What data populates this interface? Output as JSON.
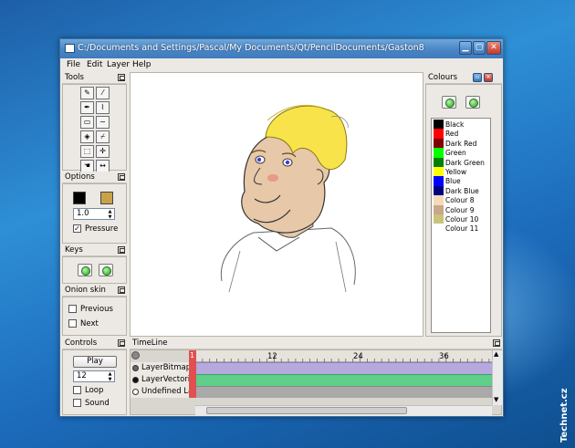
{
  "window": {
    "title": "C:/Documents and Settings/Pascal/My Documents/Qt/PencilDocuments/Gaston8"
  },
  "menu": [
    "File",
    "Edit",
    "Layer",
    "Help"
  ],
  "panels": {
    "tools": "Tools",
    "options": "Options",
    "keys": "Keys",
    "onion": "Onion skin",
    "controls": "Controls",
    "colours": "Colours",
    "timeline": "TimeLine"
  },
  "options": {
    "width_value": "1.0",
    "pressure_label": "Pressure",
    "pressure_checked": "✓",
    "stroke_color": "#000000",
    "fill_color": "#c8a24a"
  },
  "onion": {
    "previous_label": "Previous",
    "next_label": "Next"
  },
  "controls": {
    "play_label": "Play",
    "fps_value": "12",
    "loop_label": "Loop",
    "sound_label": "Sound"
  },
  "colours": [
    {
      "name": "Black",
      "color": "#000000"
    },
    {
      "name": "Red",
      "color": "#ff0000"
    },
    {
      "name": "Dark Red",
      "color": "#800000"
    },
    {
      "name": "Green",
      "color": "#00ff00"
    },
    {
      "name": "Dark Green",
      "color": "#008000"
    },
    {
      "name": "Yellow",
      "color": "#ffff00"
    },
    {
      "name": "Blue",
      "color": "#0000ff"
    },
    {
      "name": "Dark Blue",
      "color": "#000080"
    },
    {
      "name": "Colour 8",
      "color": "#f5d9b8"
    },
    {
      "name": "Colour 9",
      "color": "#c8a88a"
    },
    {
      "name": "Colour 10",
      "color": "#c9c47a"
    },
    {
      "name": "Colour 11",
      "color": "#ffffff"
    }
  ],
  "timeline": {
    "current_frame": "1",
    "ticks": [
      "12",
      "24",
      "36"
    ],
    "layers": [
      {
        "name": "LayerBitmap",
        "track_color": "#b7a9de"
      },
      {
        "name": "LayerVectorial",
        "track_color": "#5fcf8a"
      },
      {
        "name": "Undefined Layer",
        "track_color": "#a9a9a9"
      }
    ]
  },
  "watermark": "Technet.cz"
}
